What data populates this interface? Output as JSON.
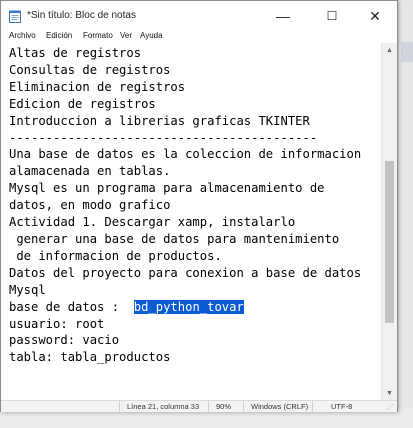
{
  "window": {
    "title": "*Sin título: Bloc de notas",
    "controls": {
      "minimize": "—",
      "maximize": "☐",
      "close": "✕"
    }
  },
  "menu": [
    "Archivo",
    "Edición",
    "Formato",
    "Ver",
    "Ayuda"
  ],
  "document": {
    "lines": [
      "Altas de registros",
      "Consultas de registros",
      "Eliminacion de registros",
      "Edicion de registros",
      "Introduccion a librerias graficas TKINTER",
      "------------------------------------------",
      "Una base de datos es la coleccion de informacion",
      "alamacenada en tablas.",
      "Mysql es un programa para almacenamiento de",
      "datos, en modo grafico",
      "Actividad 1. Descargar xamp, instalarlo",
      " generar una base de datos para mantenimiento",
      " de informacion de productos.",
      "Datos del proyecto para conexion a base de datos",
      "Mysql"
    ],
    "db_line_prefix": "base de datos :  ",
    "db_name_selected": "bd_python_tovar",
    "tail_lines": [
      "usuario: root",
      "password: vacio",
      "tabla: tabla_productos"
    ]
  },
  "status": {
    "position": "Línea 21, columna 33",
    "zoom": "90%",
    "line_ending": "Windows (CRLF)",
    "encoding": "UTF-8"
  },
  "icons": {
    "app": "notepad-icon",
    "scroll_up": "chevron-up-icon",
    "scroll_down": "chevron-down-icon",
    "grip": "resize-grip-icon"
  },
  "colors": {
    "selection": "#0a5bd4",
    "window_bg": "#ffffff",
    "statusbar_bg": "#f3f3f3"
  }
}
